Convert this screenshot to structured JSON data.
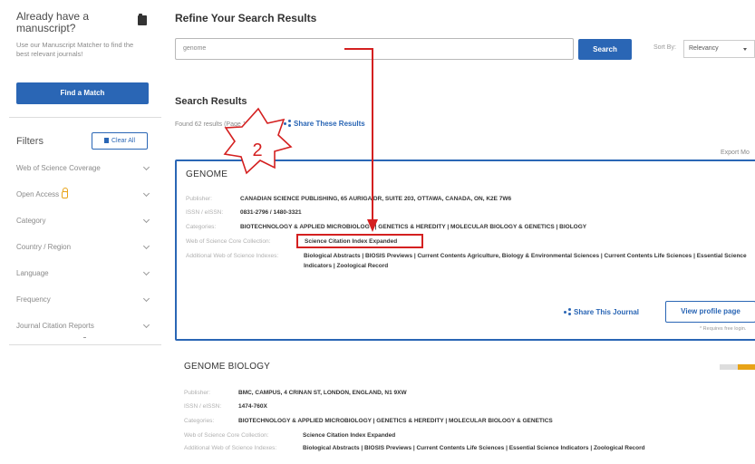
{
  "sidebar": {
    "promo_title": "Already have a manuscript?",
    "promo_desc": "Use our Manuscript Matcher to find the best relevant journals!",
    "find_match_label": "Find a Match",
    "filters_title": "Filters",
    "clear_all_label": "Clear All",
    "filters": [
      "Web of Science Coverage",
      "Open Access",
      "Category",
      "Country / Region",
      "Language",
      "Frequency",
      "Journal Citation Reports"
    ]
  },
  "main": {
    "page_title": "Refine Your Search Results",
    "search_value": "genome",
    "search_button": "Search",
    "sort_label": "Sort By:",
    "sort_value": "Relevancy",
    "results_title": "Search Results",
    "found_text": "Found 62 results (Page 1)",
    "share_results": "Share These Results",
    "export_label": "Export Mo",
    "annotation_number": "2"
  },
  "results": [
    {
      "title": "GENOME",
      "publisher_label": "Publisher:",
      "publisher": "CANADIAN SCIENCE PUBLISHING, 65 AURIGA DR, SUITE 203, OTTAWA, CANADA, ON, K2E 7W6",
      "issn_label": "ISSN / eISSN:",
      "issn": "0831-2796 / 1480-3321",
      "categories_label": "Categories:",
      "categories": "BIOTECHNOLOGY & APPLIED MICROBIOLOGY | GENETICS & HEREDITY | MOLECULAR BIOLOGY & GENETICS | BIOLOGY",
      "wos_label": "Web of Science Core Collection:",
      "wos": "Science Citation Index Expanded",
      "additional_label": "Additional Web of Science Indexes:",
      "additional": "Biological Abstracts | BIOSIS Previews | Current Contents Agriculture, Biology & Environmental Sciences | Current Contents Life Sciences | Essential Science Indicators | Zoological Record",
      "share_journal": "Share This Journal",
      "view_profile": "View profile page",
      "requires_login": "* Requires free login."
    },
    {
      "title": "GENOME BIOLOGY",
      "publisher_label": "Publisher:",
      "publisher": "BMC, CAMPUS, 4 CRINAN ST, LONDON, ENGLAND, N1 9XW",
      "issn_label": "ISSN / eISSN:",
      "issn": "1474-760X",
      "categories_label": "Categories:",
      "categories": "BIOTECHNOLOGY & APPLIED MICROBIOLOGY | GENETICS & HEREDITY | MOLECULAR BIOLOGY & GENETICS",
      "wos_label": "Web of Science Core Collection:",
      "wos": "Science Citation Index Expanded",
      "additional_label": "Additional Web of Science Indexes:",
      "additional": "Biological Abstracts | BIOSIS Previews | Current Contents Life Sciences | Essential Science Indicators | Zoological Record"
    }
  ],
  "colors": {
    "primary": "#2a66b5",
    "annotation": "#d42020",
    "open_access": "#e8a317"
  }
}
